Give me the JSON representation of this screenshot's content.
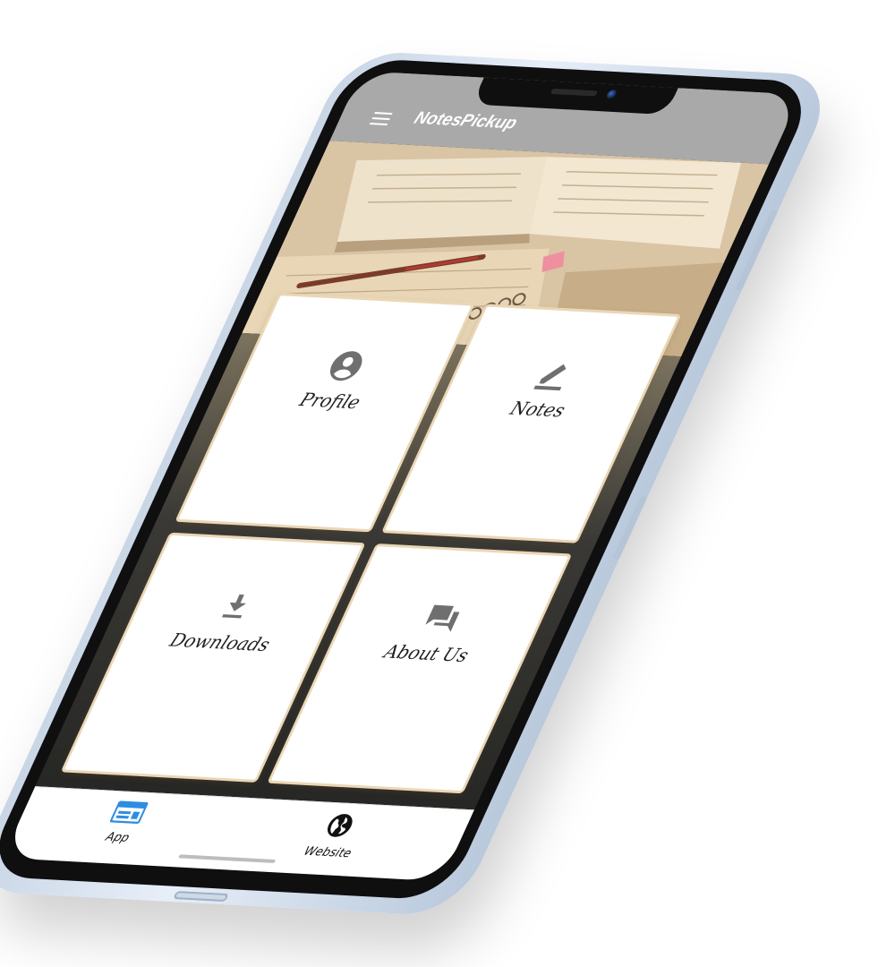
{
  "app": {
    "title": "NotesPickup"
  },
  "cards": [
    {
      "label": "Profile",
      "icon": "account-circle-icon"
    },
    {
      "label": "Notes",
      "icon": "pencil-edit-icon"
    },
    {
      "label": "Downloads",
      "icon": "download-icon"
    },
    {
      "label": "About Us",
      "icon": "forum-chat-icon"
    }
  ],
  "bottom_nav": [
    {
      "label": "App",
      "icon": "app-dashboard-icon",
      "active": true
    },
    {
      "label": "Website",
      "icon": "globe-icon",
      "active": false
    }
  ],
  "colors": {
    "appbar": "#a9a9a9",
    "active_nav": "#2e8de0",
    "card_border": "#ead7b6",
    "icon_gray": "#6f6f6f"
  }
}
